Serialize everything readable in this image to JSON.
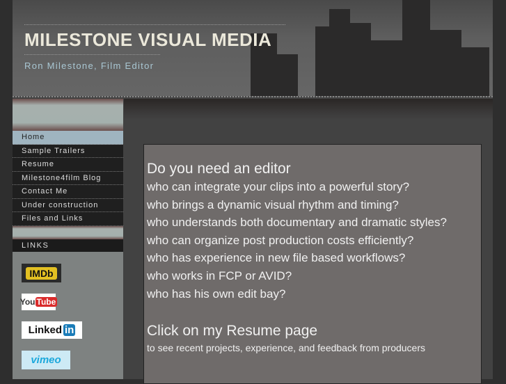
{
  "header": {
    "title": "MILESTONE VISUAL MEDIA",
    "subtitle": "Ron Milestone, Film Editor"
  },
  "nav": [
    {
      "label": "Home",
      "active": true
    },
    {
      "label": "Sample Trailers"
    },
    {
      "label": "Resume"
    },
    {
      "label": "Milestone4film Blog"
    },
    {
      "label": "Contact Me"
    },
    {
      "label": "Under construction"
    },
    {
      "label": "Files and Links"
    }
  ],
  "links": {
    "heading": "LINKS",
    "items": [
      {
        "label": "IMDb"
      },
      {
        "label": "You",
        "label2": "Tube"
      },
      {
        "label": "Linked",
        "label2": "in"
      },
      {
        "label": "vimeo"
      }
    ]
  },
  "content": {
    "heading1": "Do you need an editor",
    "lines": [
      "who can integrate your clips into a powerful story?",
      "who brings a dynamic visual rhythm and timing?",
      "who understands both documentary and dramatic styles?",
      "who can organize post production costs efficiently?",
      "who has experience in new file based workflows?",
      "who works in FCP or AVID?",
      "who has his own edit bay?"
    ],
    "heading2": "Click on my Resume page",
    "sub": "to see recent projects, experience, and feedback from producers"
  }
}
